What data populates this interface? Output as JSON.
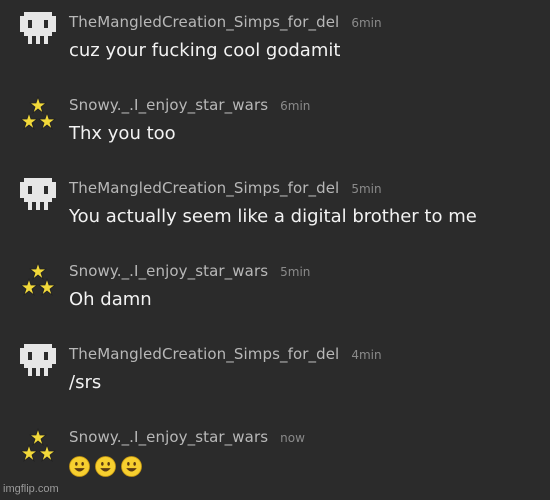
{
  "messages": [
    {
      "user": "TheMangledCreation_Simps_for_del",
      "time": "6min",
      "text": "cuz your fucking cool godamit",
      "avatar": "pixel-skull-icon"
    },
    {
      "user": "Snowy._.I_enjoy_star_wars",
      "time": "6min",
      "text": "Thx you too",
      "avatar": "stars-icon"
    },
    {
      "user": "TheMangledCreation_Simps_for_del",
      "time": "5min",
      "text": "You actually seem like a digital brother to me",
      "avatar": "pixel-skull-icon"
    },
    {
      "user": "Snowy._.I_enjoy_star_wars",
      "time": "5min",
      "text": "Oh damn",
      "avatar": "stars-icon"
    },
    {
      "user": "TheMangledCreation_Simps_for_del",
      "time": "4min",
      "text": "/srs",
      "avatar": "pixel-skull-icon"
    },
    {
      "user": "Snowy._.I_enjoy_star_wars",
      "time": "now",
      "text": "",
      "avatar": "stars-icon",
      "emojis": [
        "smiley-emoji",
        "smiley-emoji",
        "smiley-emoji"
      ]
    }
  ],
  "watermark": "imgflip.com",
  "colors": {
    "background": "#2b2b2b",
    "username": "#b8b8b8",
    "time": "#8a8a8a",
    "text": "#f2f2f2",
    "star": "#f2d93a",
    "skull": "#e6e6e6"
  }
}
